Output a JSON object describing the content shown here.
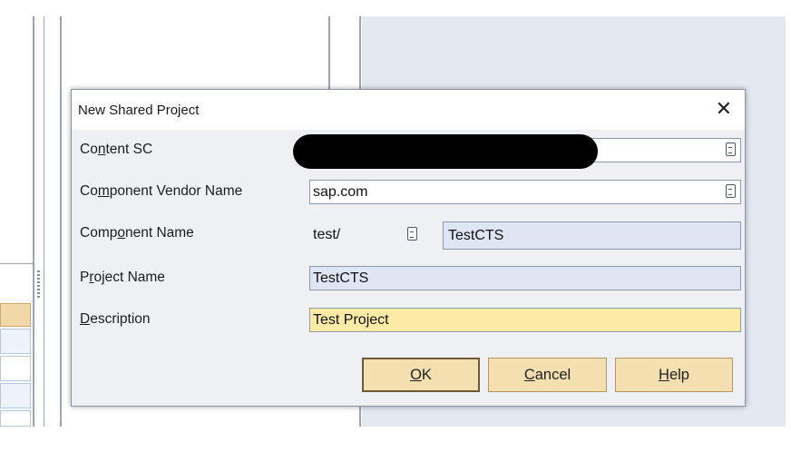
{
  "dialog": {
    "title": "New Shared Project",
    "close_glyph": "✕",
    "fields": {
      "content_sc": {
        "label_pre": "Co",
        "label_mn": "n",
        "label_post": "tent SC",
        "value": ""
      },
      "vendor": {
        "label_pre": "Co",
        "label_mn": "m",
        "label_post": "ponent Vendor Name",
        "value": "sap.com"
      },
      "component": {
        "label_pre": "Comp",
        "label_mn": "o",
        "label_post": "nent Name",
        "prefix": "test/",
        "value": "TestCTS"
      },
      "project": {
        "label_pre": "P",
        "label_mn": "r",
        "label_post": "oject Name",
        "value": "TestCTS"
      },
      "description": {
        "label_pre": "",
        "label_mn": "D",
        "label_post": "escription",
        "value": "Test Project"
      }
    },
    "buttons": {
      "ok": {
        "mn": "O",
        "rest": "K"
      },
      "cancel": {
        "mn": "C",
        "rest": "ancel"
      },
      "help": {
        "mn": "H",
        "rest": "elp"
      }
    }
  },
  "colors": {
    "button_bg": "#f4dfb1",
    "readonly_field_bg": "#dde6f2",
    "focused_field_bg": "#fdeaa4"
  },
  "icons": {
    "close": "close-icon",
    "value_help": "value-help-icon"
  }
}
